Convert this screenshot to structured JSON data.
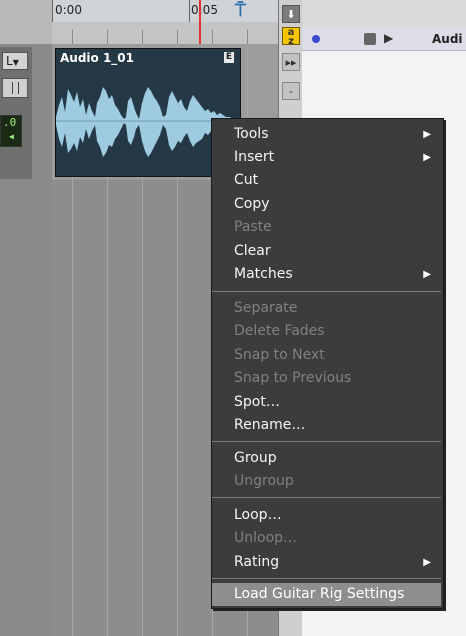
{
  "timeline": {
    "time_start": "0:00",
    "time_mark": "0:05"
  },
  "track": {
    "lr_label": "L",
    "volume": ".0"
  },
  "clip": {
    "name": "Audio 1_01"
  },
  "region_list": {
    "row_label": "Audi"
  },
  "context_menu": {
    "items": [
      {
        "label": "Tools",
        "enabled": true,
        "submenu": true
      },
      {
        "label": "Insert",
        "enabled": true,
        "submenu": true
      },
      {
        "label": "Cut",
        "enabled": true
      },
      {
        "label": "Copy",
        "enabled": true
      },
      {
        "label": "Paste",
        "enabled": false
      },
      {
        "label": "Clear",
        "enabled": true
      },
      {
        "label": "Matches",
        "enabled": true,
        "submenu": true
      },
      {
        "label": "Separate",
        "enabled": false
      },
      {
        "label": "Delete Fades",
        "enabled": false
      },
      {
        "label": "Snap to Next",
        "enabled": false
      },
      {
        "label": "Snap to Previous",
        "enabled": false
      },
      {
        "label": "Spot…",
        "enabled": true
      },
      {
        "label": "Rename…",
        "enabled": true
      },
      {
        "label": "Group",
        "enabled": true
      },
      {
        "label": "Ungroup",
        "enabled": false
      },
      {
        "label": "Loop…",
        "enabled": true
      },
      {
        "label": "Unloop…",
        "enabled": false
      },
      {
        "label": "Rating",
        "enabled": true,
        "submenu": true
      },
      {
        "label": "Load Guitar Rig Settings",
        "enabled": true,
        "highlighted": true
      }
    ]
  },
  "colors": {
    "menu_bg": "#3c3c3c",
    "highlight": "#8e8e8e",
    "waveform": "#9fcbe0",
    "clip_bg": "#243845",
    "az_button": "#f2c500",
    "playhead": "#dd3333"
  },
  "icons": {
    "submenu": "triangle-right-icon",
    "marker": "marker-icon",
    "toolstrip": [
      "arrow-down-icon",
      "az-sort-icon",
      "fast-forward-icon",
      "minus-icon"
    ]
  }
}
